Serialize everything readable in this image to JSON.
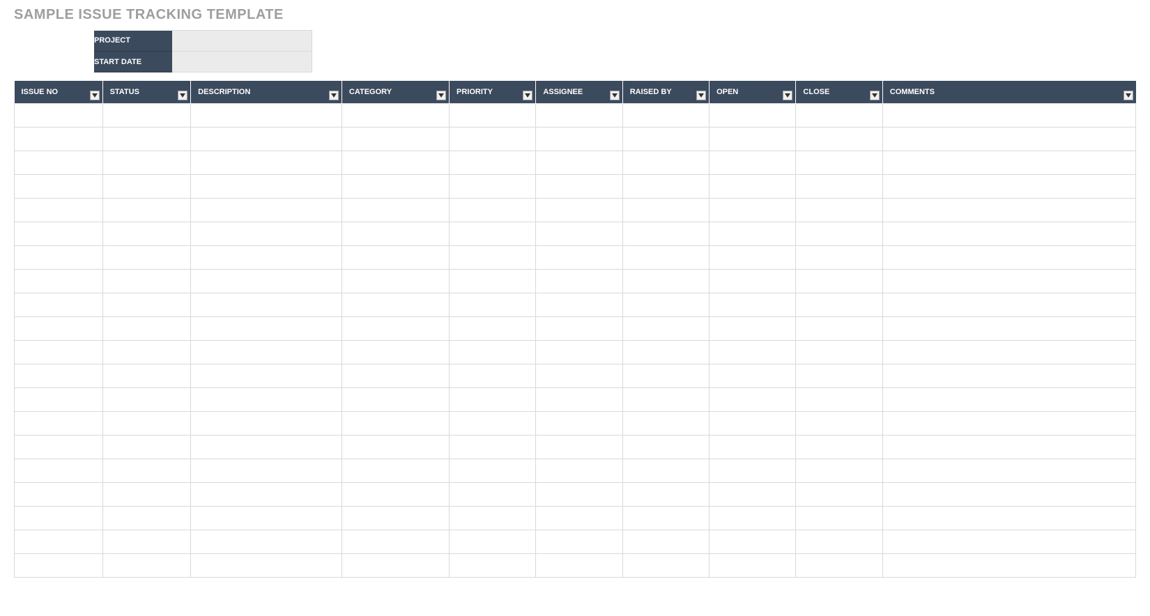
{
  "title": "SAMPLE ISSUE TRACKING TEMPLATE",
  "info": {
    "project_label": "PROJECT",
    "project_value": "",
    "start_date_label": "START DATE",
    "start_date_value": ""
  },
  "columns": [
    {
      "label": "ISSUE NO",
      "width_class": "c0"
    },
    {
      "label": "STATUS",
      "width_class": "c1"
    },
    {
      "label": "DESCRIPTION",
      "width_class": "c2"
    },
    {
      "label": "CATEGORY",
      "width_class": "c3"
    },
    {
      "label": "PRIORITY",
      "width_class": "c4"
    },
    {
      "label": "ASSIGNEE",
      "width_class": "c5"
    },
    {
      "label": "RAISED BY",
      "width_class": "c6"
    },
    {
      "label": "OPEN",
      "width_class": "c7"
    },
    {
      "label": "CLOSE",
      "width_class": "c8"
    },
    {
      "label": "COMMENTS",
      "width_class": "c9"
    }
  ],
  "rows": [
    [
      "",
      "",
      "",
      "",
      "",
      "",
      "",
      "",
      "",
      ""
    ],
    [
      "",
      "",
      "",
      "",
      "",
      "",
      "",
      "",
      "",
      ""
    ],
    [
      "",
      "",
      "",
      "",
      "",
      "",
      "",
      "",
      "",
      ""
    ],
    [
      "",
      "",
      "",
      "",
      "",
      "",
      "",
      "",
      "",
      ""
    ],
    [
      "",
      "",
      "",
      "",
      "",
      "",
      "",
      "",
      "",
      ""
    ],
    [
      "",
      "",
      "",
      "",
      "",
      "",
      "",
      "",
      "",
      ""
    ],
    [
      "",
      "",
      "",
      "",
      "",
      "",
      "",
      "",
      "",
      ""
    ],
    [
      "",
      "",
      "",
      "",
      "",
      "",
      "",
      "",
      "",
      ""
    ],
    [
      "",
      "",
      "",
      "",
      "",
      "",
      "",
      "",
      "",
      ""
    ],
    [
      "",
      "",
      "",
      "",
      "",
      "",
      "",
      "",
      "",
      ""
    ],
    [
      "",
      "",
      "",
      "",
      "",
      "",
      "",
      "",
      "",
      ""
    ],
    [
      "",
      "",
      "",
      "",
      "",
      "",
      "",
      "",
      "",
      ""
    ],
    [
      "",
      "",
      "",
      "",
      "",
      "",
      "",
      "",
      "",
      ""
    ],
    [
      "",
      "",
      "",
      "",
      "",
      "",
      "",
      "",
      "",
      ""
    ],
    [
      "",
      "",
      "",
      "",
      "",
      "",
      "",
      "",
      "",
      ""
    ],
    [
      "",
      "",
      "",
      "",
      "",
      "",
      "",
      "",
      "",
      ""
    ],
    [
      "",
      "",
      "",
      "",
      "",
      "",
      "",
      "",
      "",
      ""
    ],
    [
      "",
      "",
      "",
      "",
      "",
      "",
      "",
      "",
      "",
      ""
    ],
    [
      "",
      "",
      "",
      "",
      "",
      "",
      "",
      "",
      "",
      ""
    ],
    [
      "",
      "",
      "",
      "",
      "",
      "",
      "",
      "",
      "",
      ""
    ]
  ]
}
